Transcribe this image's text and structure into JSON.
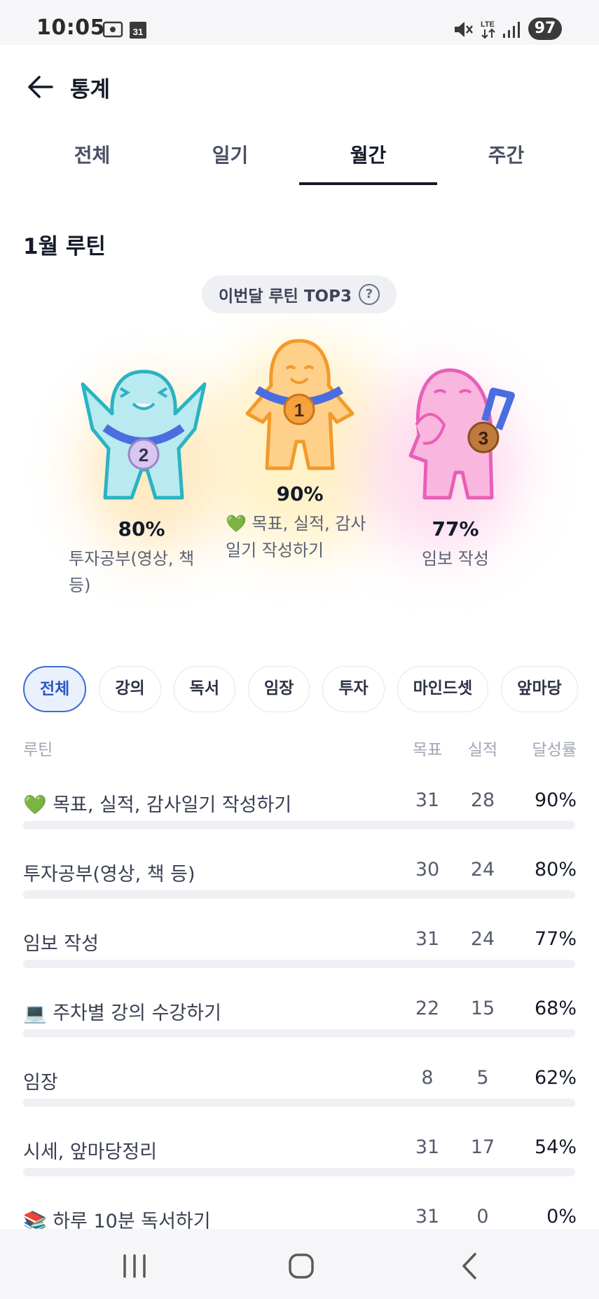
{
  "status": {
    "time": "10:05",
    "battery": "97",
    "network": "LTE"
  },
  "header": {
    "title": "통계"
  },
  "tabs": [
    {
      "label": "전체",
      "active": false
    },
    {
      "label": "일기",
      "active": false
    },
    {
      "label": "월간",
      "active": true
    },
    {
      "label": "주간",
      "active": false
    }
  ],
  "section": {
    "title": "1월 루틴"
  },
  "top3": {
    "label": "이번달 루틴 TOP3",
    "help": "?",
    "first": {
      "rank": "1",
      "percent": "90%",
      "name_line1": "💚 목표, 실적, 감사",
      "name_line2": "일기 작성하기",
      "color": "#f7a43a"
    },
    "second": {
      "rank": "2",
      "percent": "80%",
      "name_line1": "투자공부(영상, 책",
      "name_line2": "등)",
      "color": "#4fc3d0"
    },
    "third": {
      "rank": "3",
      "percent": "77%",
      "name_line1": "임보 작성",
      "name_line2": "",
      "color": "#f079c6"
    }
  },
  "filters": [
    "전체",
    "강의",
    "독서",
    "임장",
    "투자",
    "마인드셋",
    "앞마당"
  ],
  "table": {
    "headers": {
      "name": "루틴",
      "goal": "목표",
      "done": "실적",
      "rate": "달성률"
    },
    "rows": [
      {
        "name": "💚 목표, 실적, 감사일기 작성하기",
        "goal": "31",
        "done": "28",
        "rate": "90%"
      },
      {
        "name": "투자공부(영상, 책 등)",
        "goal": "30",
        "done": "24",
        "rate": "80%"
      },
      {
        "name": "임보 작성",
        "goal": "31",
        "done": "24",
        "rate": "77%"
      },
      {
        "name": "💻 주차별 강의 수강하기",
        "goal": "22",
        "done": "15",
        "rate": "68%"
      },
      {
        "name": "임장",
        "goal": "8",
        "done": "5",
        "rate": "62%"
      },
      {
        "name": "시세, 앞마당정리",
        "goal": "31",
        "done": "17",
        "rate": "54%"
      },
      {
        "name": "📚 하루 10분 독서하기",
        "goal": "31",
        "done": "0",
        "rate": "0%"
      }
    ]
  }
}
